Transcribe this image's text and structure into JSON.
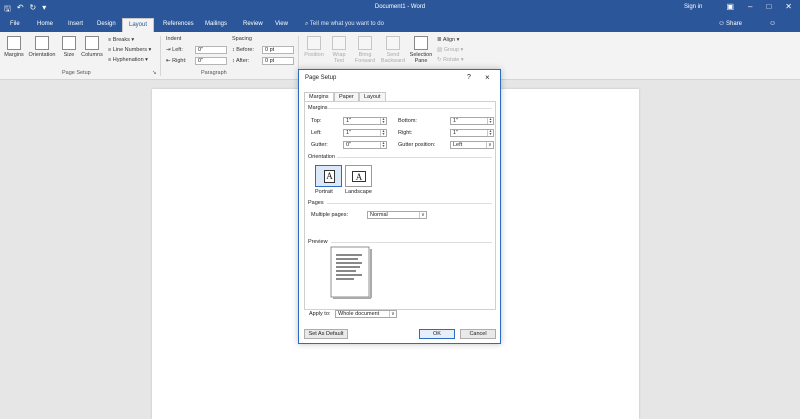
{
  "titlebar": {
    "title": "Document1 - Word",
    "signin": "Sign in",
    "icons": [
      "save-icon",
      "undo-icon",
      "redo-icon",
      "customize-icon"
    ]
  },
  "tabs": [
    "File",
    "Home",
    "Insert",
    "Design",
    "Layout",
    "References",
    "Mailings",
    "Review",
    "View"
  ],
  "active_tab": "Layout",
  "tellme": "Tell me what you want to do",
  "share": "Share",
  "ribbon": {
    "margins": "Margins",
    "orientation": "Orientation",
    "size": "Size",
    "columns": "Columns",
    "breaks": "Breaks",
    "line_numbers": "Line Numbers",
    "hyphenation": "Hyphenation",
    "page_setup_group": "Page Setup",
    "indent": "Indent",
    "indent_left": "Left:",
    "indent_left_val": "0\"",
    "indent_right": "Right:",
    "indent_right_val": "0\"",
    "spacing": "Spacing",
    "before": "Before:",
    "before_val": "0 pt",
    "after": "After:",
    "after_val": "0 pt",
    "paragraph_group": "Paragraph",
    "position": "Position",
    "wrap_text": "Wrap Text",
    "bring_forward": "Bring Forward",
    "send_backward": "Send Backward",
    "selection_pane": "Selection Pane",
    "align": "Align",
    "group": "Group",
    "rotate": "Rotate"
  },
  "dialog": {
    "title": "Page Setup",
    "help": "?",
    "close": "×",
    "tabs": [
      "Margins",
      "Paper",
      "Layout"
    ],
    "margins_section": "Margins",
    "top_label": "Top:",
    "top_value": "1\"",
    "bottom_label": "Bottom:",
    "bottom_value": "1\"",
    "left_label": "Left:",
    "left_value": "1\"",
    "right_label": "Right:",
    "right_value": "1\"",
    "gutter_label": "Gutter:",
    "gutter_value": "0\"",
    "gutter_position_label": "Gutter position:",
    "gutter_position_value": "Left",
    "orientation_section": "Orientation",
    "portrait": "Portrait",
    "landscape": "Landscape",
    "pages_section": "Pages",
    "multiple_pages_label": "Multiple pages:",
    "multiple_pages_value": "Normal",
    "preview_section": "Preview",
    "apply_to_label": "Apply to:",
    "apply_to_value": "Whole document",
    "set_default": "Set As Default",
    "ok": "OK",
    "cancel": "Cancel"
  },
  "colors": {
    "accent": "#2b579a",
    "ribbon_bg": "#f3f3f3",
    "canvas_bg": "#e6e6e6",
    "dialog_border": "#2b6cc2"
  }
}
